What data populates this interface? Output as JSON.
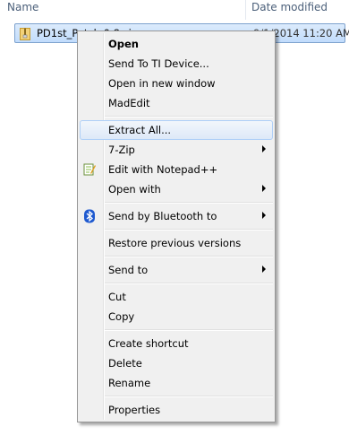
{
  "columns": {
    "name_label": "Name",
    "date_label": "Date modified"
  },
  "file": {
    "name": "PD1st_Patch 0.8.zip",
    "date_modified": "9/1/2014 11:20 AM",
    "icon": "zip-folder-icon"
  },
  "context_menu": {
    "items": [
      {
        "label": "Open",
        "bold": true
      },
      {
        "label": "Send To TI Device..."
      },
      {
        "label": "Open in new window"
      },
      {
        "label": "MadEdit"
      },
      {
        "label": "Extract All...",
        "highlighted": true
      },
      {
        "label": "7-Zip",
        "submenu": true
      },
      {
        "label": "Edit with Notepad++",
        "icon": "notepad-plus-plus-icon"
      },
      {
        "label": "Open with",
        "submenu": true
      },
      {
        "label": "Send by Bluetooth to",
        "submenu": true,
        "icon": "bluetooth-icon"
      },
      {
        "label": "Restore previous versions"
      },
      {
        "label": "Send to",
        "submenu": true
      },
      {
        "label": "Cut"
      },
      {
        "label": "Copy"
      },
      {
        "label": "Create shortcut"
      },
      {
        "label": "Delete"
      },
      {
        "label": "Rename"
      },
      {
        "label": "Properties"
      }
    ]
  },
  "colors": {
    "selection": "#c1dcfc",
    "menu_background": "#f0f0f0",
    "bluetooth": "#1f5ad0"
  }
}
